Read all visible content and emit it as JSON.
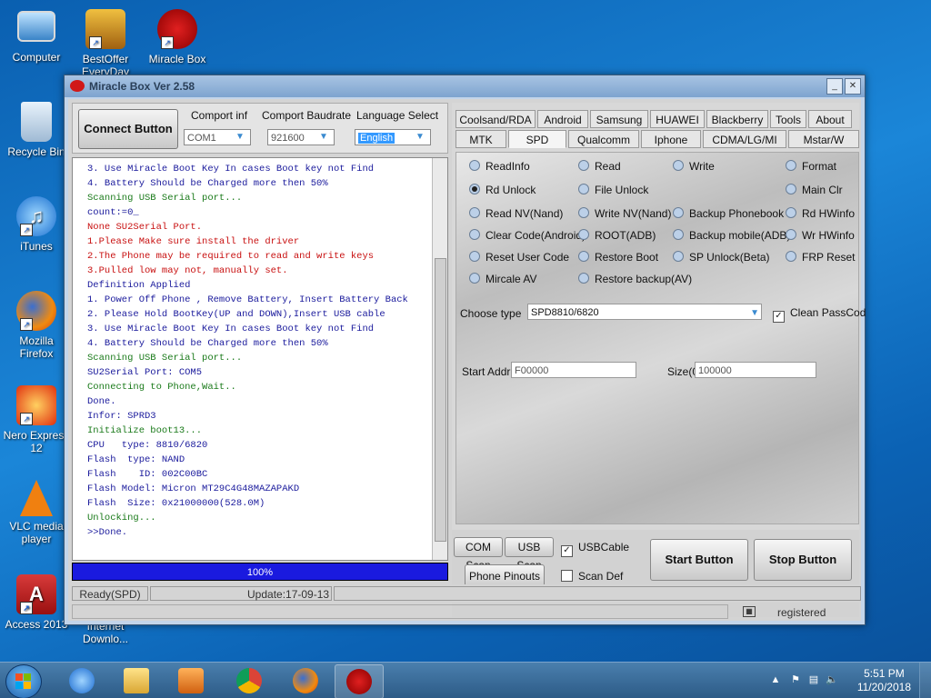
{
  "desktop": {
    "icons": [
      {
        "label": "Computer"
      },
      {
        "label": "BestOffer EveryDay"
      },
      {
        "label": "Miracle Box"
      },
      {
        "label": "Recycle Bin"
      },
      {
        "label": "iTunes"
      },
      {
        "label": "Mozilla Firefox"
      },
      {
        "label": "Nero Express 12"
      },
      {
        "label": "VLC media player"
      },
      {
        "label": "Access 2013"
      },
      {
        "label": "Internet Downlo..."
      }
    ]
  },
  "window": {
    "title": "Miracle Box Ver 2.58",
    "minimize": "_",
    "close": "✕",
    "connect_button": "Connect Button",
    "comport_label": "Comport inf",
    "comport_value": "COM1",
    "baud_label": "Comport Baudrate",
    "baud_value": "921600",
    "language_label": "Language Select",
    "language_value": "English",
    "log": [
      {
        "text": "3. Use Miracle Boot Key In cases Boot key not Find",
        "color": "#1a1a9c"
      },
      {
        "text": "4. Battery Should be Charged more then 50%",
        "color": "#1a1a9c"
      },
      {
        "text": "Scanning USB Serial port...",
        "color": "#1a7a1a"
      },
      {
        "text": "count:=0_",
        "color": "#1a1a9c"
      },
      {
        "text": "None SU2Serial Port.",
        "color": "#c81010"
      },
      {
        "text": "1.Please Make sure install the driver",
        "color": "#c81010"
      },
      {
        "text": "2.The Phone may be required to read and write keys",
        "color": "#c81010"
      },
      {
        "text": "3.Pulled low may not, manually set.",
        "color": "#c81010"
      },
      {
        "text": "Definition Applied",
        "color": "#1a1a9c"
      },
      {
        "text": "1. Power Off Phone , Remove Battery, Insert Battery Back",
        "color": "#1a1a9c"
      },
      {
        "text": "2. Please Hold BootKey(UP and DOWN),Insert USB cable",
        "color": "#1a1a9c"
      },
      {
        "text": "3. Use Miracle Boot Key In cases Boot key not Find",
        "color": "#1a1a9c"
      },
      {
        "text": "4. Battery Should be Charged more then 50%",
        "color": "#1a1a9c"
      },
      {
        "text": "Scanning USB Serial port...",
        "color": "#1a7a1a"
      },
      {
        "text": "SU2Serial Port: COM5",
        "color": "#1a1a9c"
      },
      {
        "text": "Connecting to Phone,Wait..",
        "color": "#1a7a1a"
      },
      {
        "text": "Done.",
        "color": "#1a1a9c"
      },
      {
        "text": "Infor: SPRD3",
        "color": "#1a1a9c"
      },
      {
        "text": "Initialize boot13...",
        "color": "#1a7a1a"
      },
      {
        "text": "CPU   type: 8810/6820",
        "color": "#1a1a9c"
      },
      {
        "text": "Flash  type: NAND",
        "color": "#1a1a9c"
      },
      {
        "text": "Flash    ID: 002C00BC",
        "color": "#1a1a9c"
      },
      {
        "text": "Flash Model: Micron MT29C4G48MAZAPAKD",
        "color": "#1a1a9c"
      },
      {
        "text": "Flash  Size: 0x21000000(528.0M)",
        "color": "#1a1a9c"
      },
      {
        "text": "Unlocking...",
        "color": "#1a7a1a"
      },
      {
        "text": ">>Done.",
        "color": "#1a1a9c"
      }
    ],
    "progress": {
      "label": "100%",
      "value": 1.0
    },
    "status_mode": "Ready(SPD)",
    "status_update": "Update:17-09-13",
    "status_registered": "registered",
    "tabs_row1": [
      "Coolsand/RDA",
      "Android",
      "Samsung",
      "HUAWEI",
      "Blackberry",
      "Tools",
      "About"
    ],
    "tabs_row2": [
      "MTK",
      "SPD",
      "Qualcomm",
      "Iphone",
      "CDMA/LG/MI",
      "Mstar/W"
    ],
    "active_tab": "SPD",
    "options": [
      [
        "ReadInfo",
        "Read",
        "Write",
        "Format"
      ],
      [
        "Rd Unlock",
        "File Unlock",
        "",
        "Main Clr"
      ],
      [
        "Read NV(Nand)",
        "Write NV(Nand)",
        "Backup Phonebook",
        "Rd HWinfo"
      ],
      [
        "Clear Code(Android)",
        "ROOT(ADB)",
        "Backup mobile(ADB)",
        "Wr HWinfo"
      ],
      [
        "Reset User Code",
        "Restore Boot",
        "SP Unlock(Beta)",
        "FRP Reset"
      ],
      [
        "Mircale AV",
        "Restore backup(AV)",
        "",
        ""
      ]
    ],
    "selected_option": "Rd Unlock",
    "choose_type_label": "Choose  type",
    "choose_type_value": "SPD8810/6820",
    "clean_passcode_label": "Clean PassCod",
    "start_addr_label": "Start Addr(0",
    "start_addr_value": "F00000",
    "size_label": "Size(0",
    "size_value": "100000",
    "com_scan": "COM Scan",
    "usb_scan": "USB Scan",
    "usb_cable_label": "USBCable",
    "phone_pinouts": "Phone Pinouts",
    "scan_def_label": "Scan Def",
    "start_button": "Start Button",
    "stop_button": "Stop Button"
  },
  "taskbar": {
    "time": "5:51 PM",
    "date": "11/20/2018"
  },
  "colors": {
    "progress": "#1a1adf",
    "log_blue": "#1a1a9c",
    "log_green": "#1a7a1a",
    "log_red": "#c81010"
  }
}
